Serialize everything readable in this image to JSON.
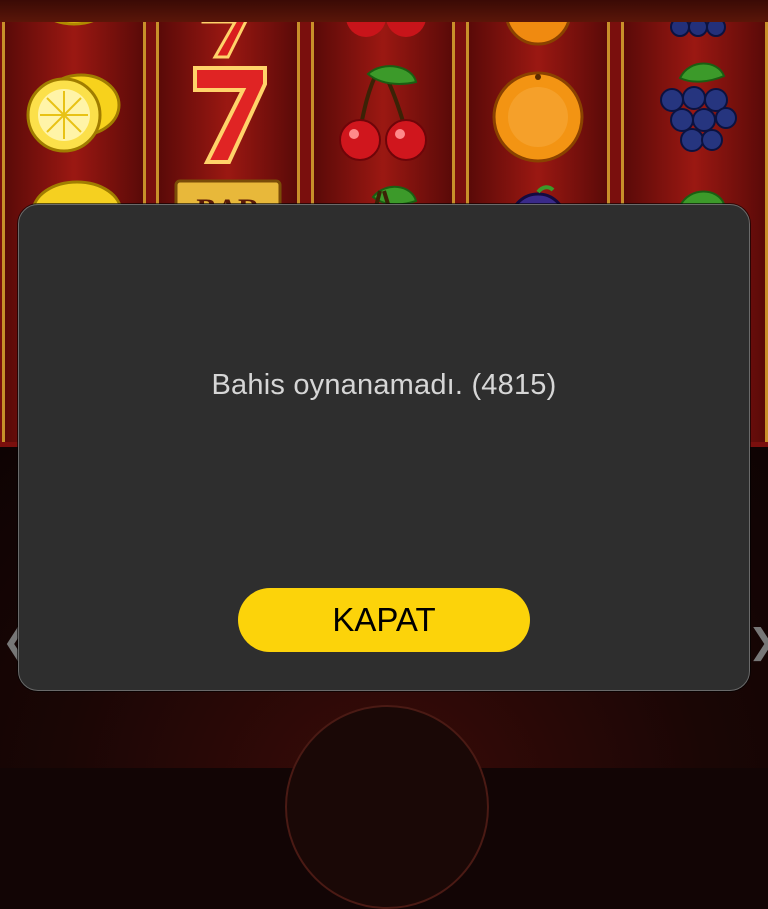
{
  "game": {
    "reels": [
      [
        "lemon",
        "lemon",
        "lemon"
      ],
      [
        "seven",
        "seven",
        "bar"
      ],
      [
        "cherry",
        "cherry",
        "cherry"
      ],
      [
        "orange",
        "orange",
        "plum"
      ],
      [
        "grapes",
        "grapes",
        "grapes"
      ]
    ],
    "bar_symbol_text": "BAR",
    "nav_left_glyph": "❮",
    "nav_right_glyph": "❯"
  },
  "dialog": {
    "message": "Bahis oynanamadı. (4815)",
    "close_label": "KAPAT"
  },
  "colors": {
    "dialog_bg": "#2e2e2e",
    "button_bg": "#fcd30a",
    "reel_frame": "#c8902a"
  }
}
